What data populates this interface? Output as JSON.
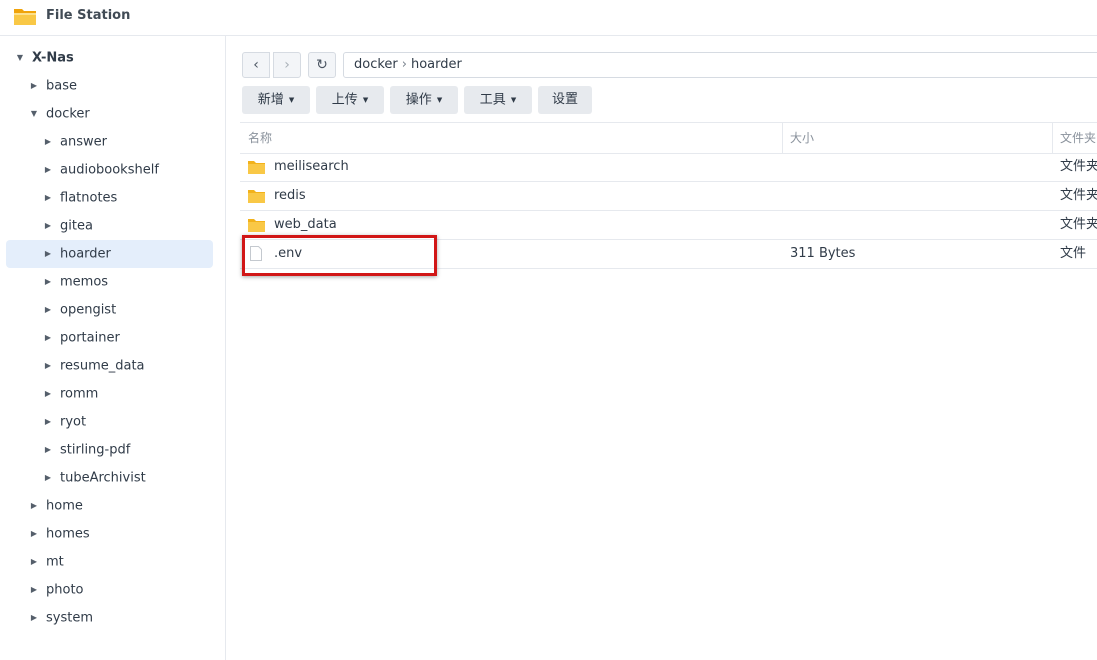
{
  "window": {
    "title": "File Station",
    "icon": "file-station-folder-icon"
  },
  "sidebar": {
    "root": "X-Nas",
    "items": [
      {
        "label": "base",
        "expanded": false
      },
      {
        "label": "docker",
        "expanded": true
      },
      {
        "label": "answer"
      },
      {
        "label": "audiobookshelf"
      },
      {
        "label": "flatnotes"
      },
      {
        "label": "gitea"
      },
      {
        "label": "hoarder",
        "selected": true
      },
      {
        "label": "memos"
      },
      {
        "label": "opengist"
      },
      {
        "label": "portainer"
      },
      {
        "label": "resume_data"
      },
      {
        "label": "romm"
      },
      {
        "label": "ryot"
      },
      {
        "label": "stirling-pdf"
      },
      {
        "label": "tubeArchivist"
      },
      {
        "label": "home"
      },
      {
        "label": "homes"
      },
      {
        "label": "mt"
      },
      {
        "label": "photo"
      },
      {
        "label": "system"
      }
    ]
  },
  "nav": {
    "path": [
      "docker",
      "hoarder"
    ],
    "separator": "›"
  },
  "toolbar": {
    "new_label": "新增",
    "upload_label": "上传",
    "action_label": "操作",
    "tools_label": "工具",
    "settings_label": "设置"
  },
  "table": {
    "columns": [
      "名称",
      "大小",
      "文件夹"
    ],
    "rows": [
      {
        "name": "meilisearch",
        "size": "",
        "type": "文件夹",
        "kind": "folder"
      },
      {
        "name": "redis",
        "size": "",
        "type": "文件夹",
        "kind": "folder"
      },
      {
        "name": "web_data",
        "size": "",
        "type": "文件夹",
        "kind": "folder"
      },
      {
        "name": ".env",
        "size": "311 Bytes",
        "type": "文件",
        "kind": "file"
      }
    ]
  },
  "colors": {
    "accent_selected": "#e4eefb",
    "highlight": "#d11616",
    "folder": "#f7c244"
  }
}
